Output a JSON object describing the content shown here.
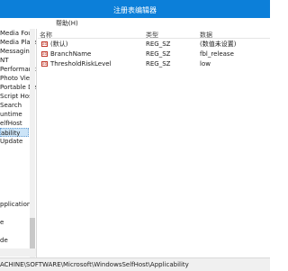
{
  "window": {
    "title": "注册表编辑器"
  },
  "menu": [
    "",
    "",
    "",
    "帮助(H)"
  ],
  "tree": {
    "items": [
      "Media Four",
      "Media Playe",
      "Messaging",
      "NT",
      "Performanc",
      "Photo View",
      "Portable De",
      "Script Host",
      "Search",
      "untime",
      "elfHost",
      "ability",
      "Update",
      "",
      "",
      "",
      "",
      "",
      "pplications",
      "e",
      "",
      "",
      "de",
      ""
    ],
    "selected_index": 11
  },
  "list": {
    "columns": [
      "名称",
      "类型",
      "数据"
    ],
    "rows": [
      {
        "icon": "string-value-icon",
        "name": "(默认)",
        "type": "REG_SZ",
        "data": "(数值未设置)"
      },
      {
        "icon": "string-value-icon",
        "name": "BranchName",
        "type": "REG_SZ",
        "data": "fbl_release"
      },
      {
        "icon": "string-value-icon",
        "name": "ThresholdRiskLevel",
        "type": "REG_SZ",
        "data": "low"
      }
    ]
  },
  "status": {
    "path": "ACHINE\\SOFTWARE\\Microsoft\\WindowsSelfHost\\Applicability"
  },
  "colors": {
    "titlebar": "#0c7fd9",
    "selection": "#cce4f7"
  }
}
